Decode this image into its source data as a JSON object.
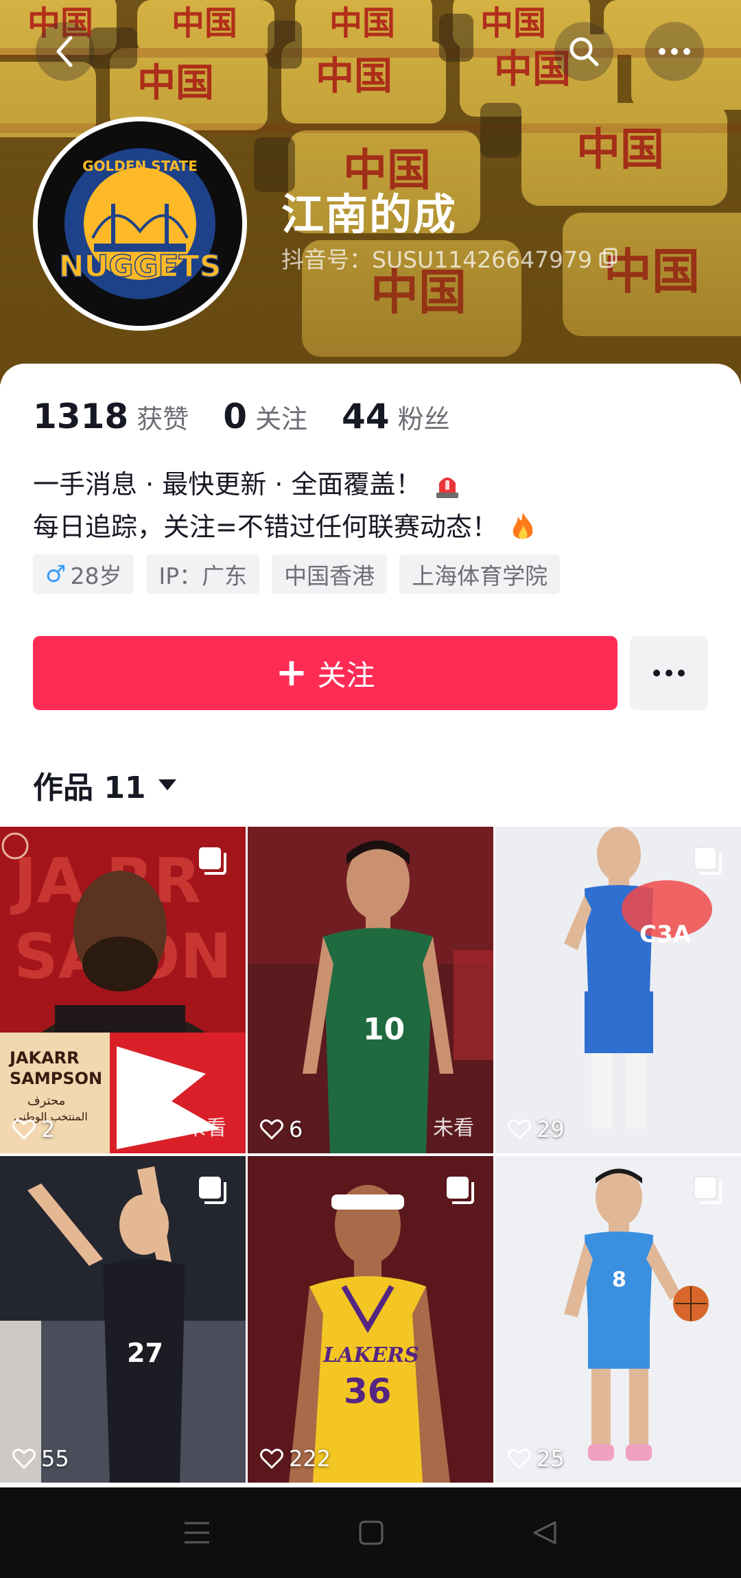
{
  "header": {
    "nickname": "江南的成",
    "douyin_id": "抖音号：SUSU11426647979",
    "avatar": {
      "logo_top_text": "GOLDEN STATE",
      "logo_main_text": "NUGGETS"
    }
  },
  "stats": [
    {
      "value": "1318",
      "label": "获赞"
    },
    {
      "value": "0",
      "label": "关注"
    },
    {
      "value": "44",
      "label": "粉丝"
    }
  ],
  "bio": {
    "line1": "一手消息 · 最快更新 · 全面覆盖！",
    "line2": "每日追踪，关注=不错过任何联赛动态！"
  },
  "tags": [
    {
      "icon": "male-icon",
      "text": "28岁"
    },
    {
      "text": "IP：广东"
    },
    {
      "text": "中国香港"
    },
    {
      "text": "上海体育学院"
    }
  ],
  "actions": {
    "follow_label": "关注"
  },
  "works": {
    "tab_label": "作品 11"
  },
  "videos": [
    {
      "likes": "2",
      "status": "未看",
      "overlay_text_1": "JAKARR",
      "overlay_text_2": "SAMPSON",
      "overlay_text_3": "محترف",
      "overlay_text_4": "المنتخب الوطني"
    },
    {
      "likes": "6",
      "status": "未看",
      "jersey_text": "10"
    },
    {
      "likes": "29",
      "status": "",
      "jersey_text": "C3A"
    },
    {
      "likes": "55",
      "status": "",
      "jersey_text": "27"
    },
    {
      "likes": "222",
      "status": "",
      "jersey_text": "36",
      "team_text": "LAKERS"
    },
    {
      "likes": "25",
      "status": "",
      "jersey_text": "8"
    }
  ],
  "colors": {
    "accent": "#fe2c55",
    "banner": "#c8a53a",
    "jersey_yellow": "#f3c623"
  }
}
